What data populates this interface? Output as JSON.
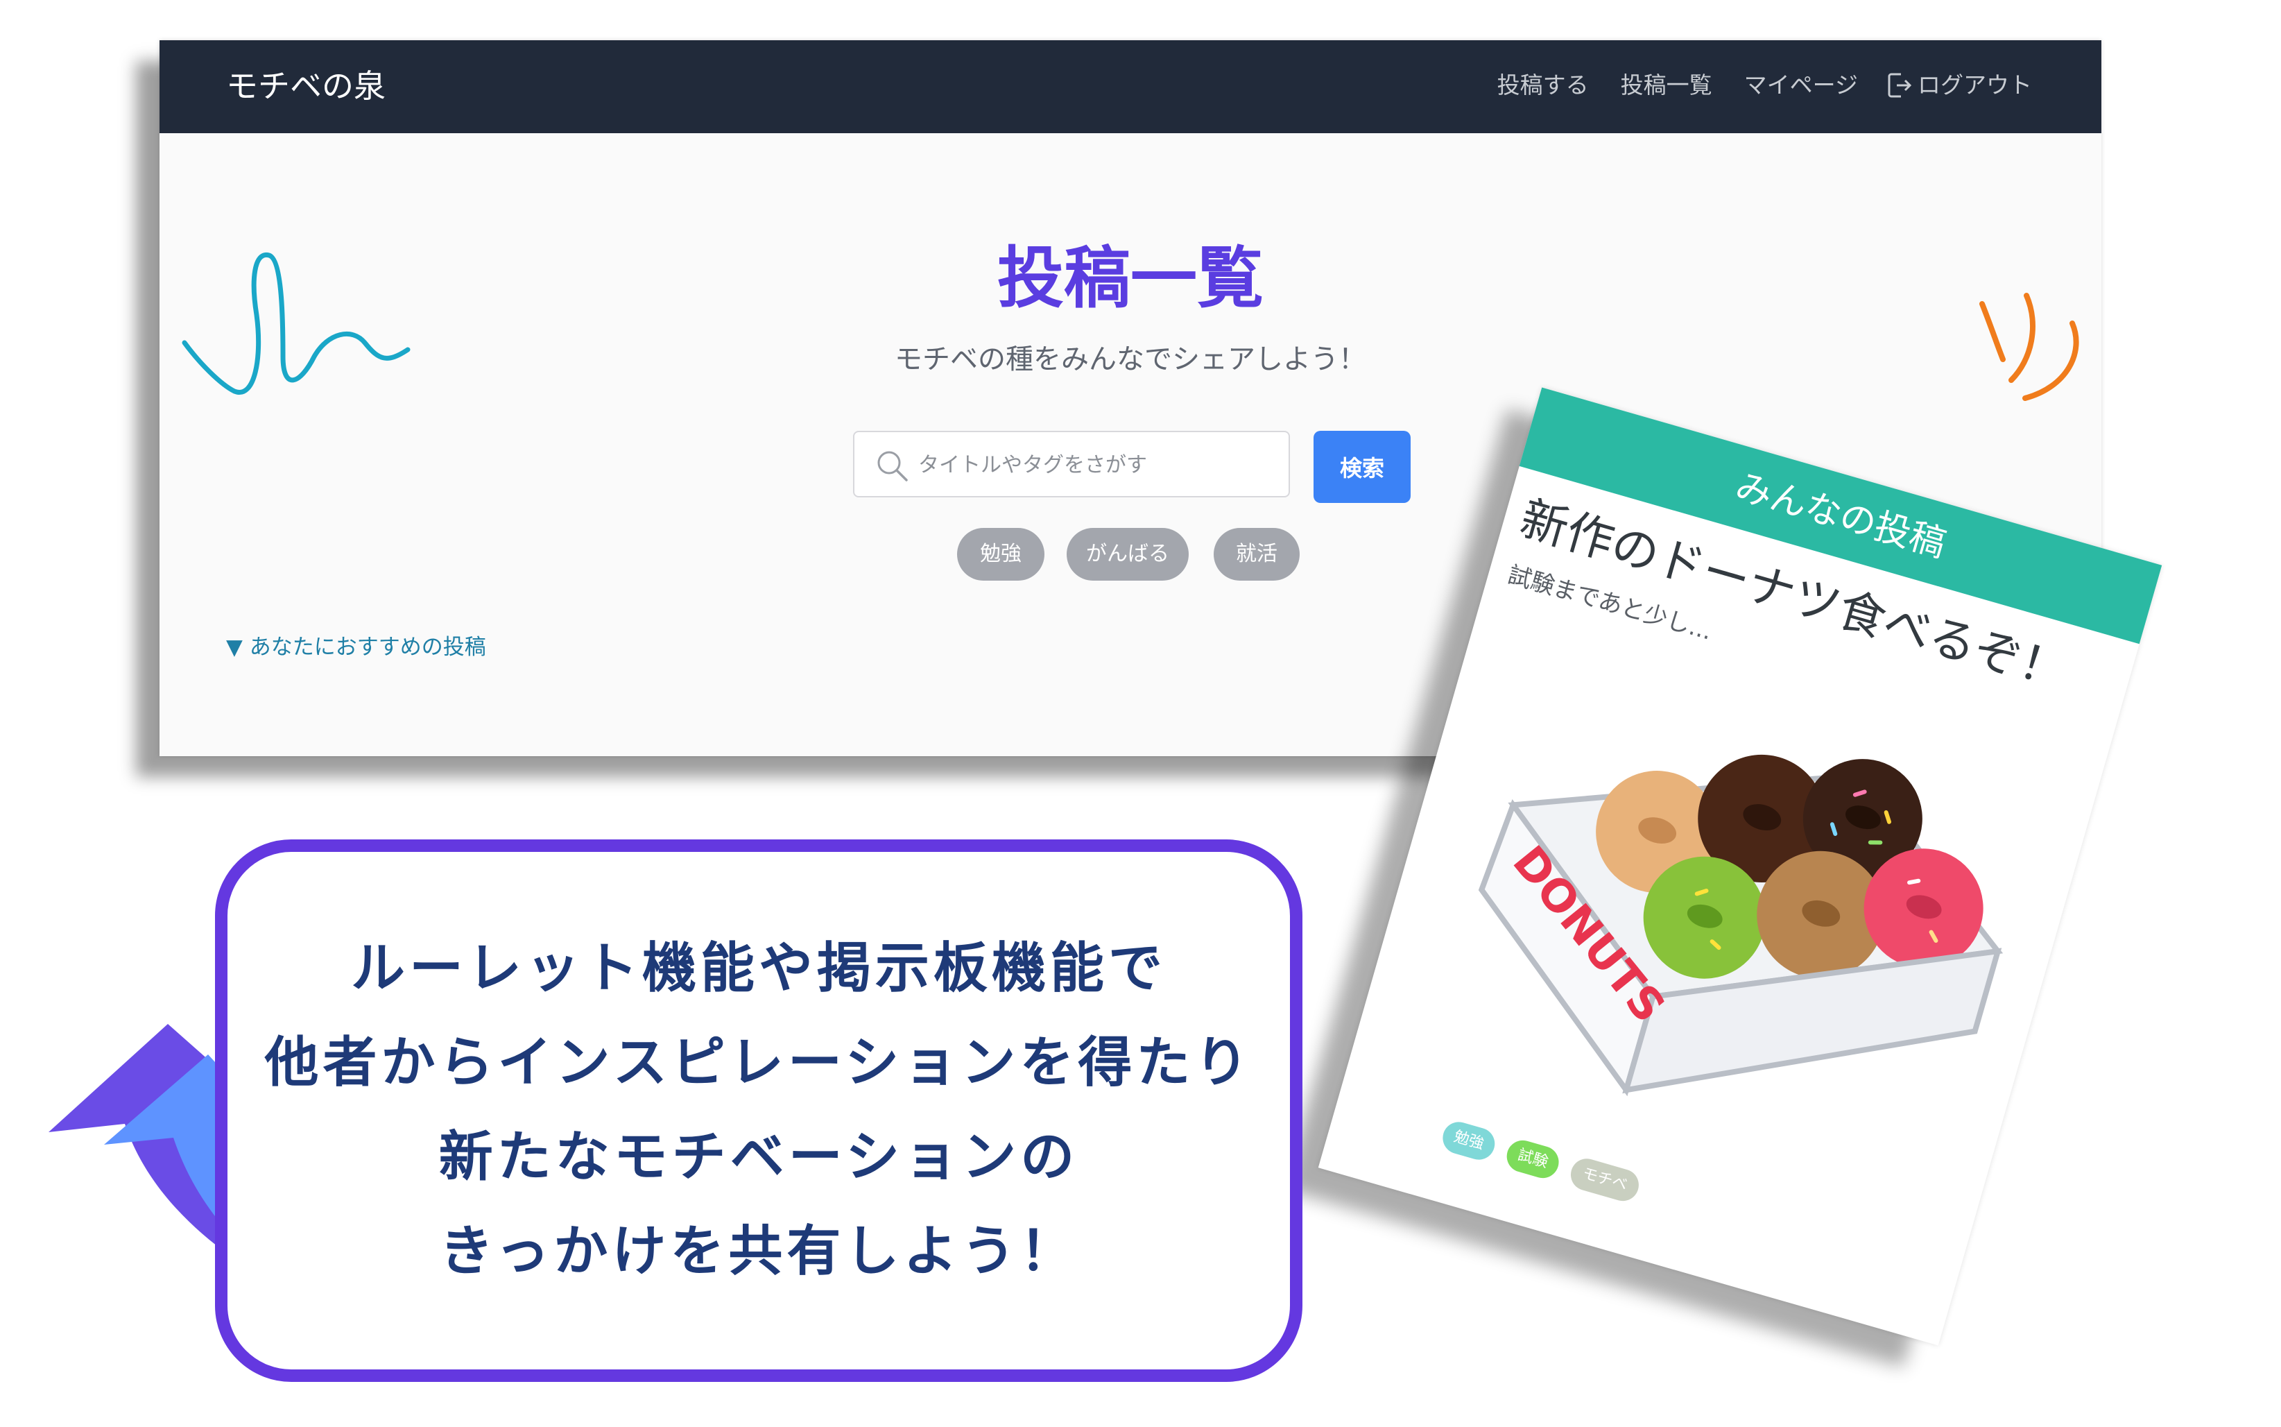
{
  "navbar": {
    "brand": "モチベの泉",
    "links": [
      "投稿する",
      "投稿一覧",
      "マイページ"
    ],
    "logout": "ログアウト"
  },
  "main": {
    "title": "投稿一覧",
    "subtitle": "モチベの種をみんなでシェアしよう！",
    "search": {
      "placeholder": "タイトルやタグをさがす",
      "button": "検索"
    },
    "tags": [
      "勉強",
      "がんばる",
      "就活"
    ],
    "recommend": "▼ あなたにおすすめの投稿"
  },
  "card": {
    "header": "みんなの投稿",
    "title": "新作のドーナツ食べるぞ！",
    "subtitle": "試験まであと少し...",
    "box_label": "DONUTS",
    "tags": [
      {
        "label": "勉強",
        "color": "#7fd8d8"
      },
      {
        "label": "試験",
        "color": "#7ddc5a"
      },
      {
        "label": "モチベ",
        "color": "#c9cfc0"
      }
    ]
  },
  "callout": {
    "lines": [
      "ルーレット機能や掲示板機能で",
      "他者からインスピレーションを得たり",
      "新たなモチベーションの",
      "きっかけを共有しよう！"
    ]
  },
  "colors": {
    "navbar": "#212a3a",
    "title": "#5a3de0",
    "search_button": "#3b82f6",
    "tag": "#a3a6ad",
    "card_header": "#2bb9a3",
    "callout_border": "#6438e0",
    "arrow": "#5e93ff",
    "squiggle_blue": "#1aa7c8",
    "squiggle_orange": "#f07c1c"
  }
}
